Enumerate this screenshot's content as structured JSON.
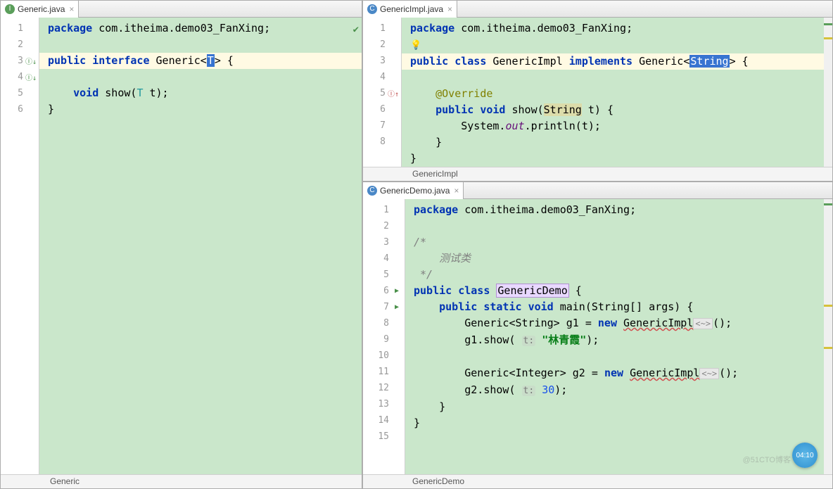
{
  "panes": {
    "left": {
      "tab": "Generic.java",
      "breadcrumb": "Generic",
      "lines": [
        "1",
        "2",
        "3",
        "4",
        "5",
        "6"
      ]
    },
    "topright": {
      "tab": "GenericImpl.java",
      "breadcrumb": "GenericImpl",
      "lines": [
        "1",
        "2",
        "3",
        "4",
        "5",
        "6",
        "7",
        "8"
      ]
    },
    "bottomright": {
      "tab": "GenericDemo.java",
      "breadcrumb": "GenericDemo",
      "lines": [
        "1",
        "2",
        "3",
        "4",
        "5",
        "6",
        "7",
        "8",
        "9",
        "10",
        "11",
        "12",
        "13",
        "14",
        "15"
      ]
    }
  },
  "code": {
    "pkgDecl": "com.itheima.demo03_FanXing",
    "kw": {
      "package": "package",
      "public": "public",
      "interface": "interface",
      "class": "class",
      "void": "void",
      "implements": "implements",
      "new": "new",
      "static": "static"
    },
    "generic": {
      "ifaceName": "Generic",
      "typeParam": "T",
      "method": "show",
      "param": "t"
    },
    "impl": {
      "className": "GenericImpl",
      "superIface": "Generic",
      "typeArg": "String",
      "override": "@Override",
      "paramType": "String",
      "body": "System.",
      "out": "out",
      "printlnCall": ".println(t);"
    },
    "demo": {
      "className": "GenericDemo",
      "commentOpen": "/*",
      "commentBody": "    测试类",
      "commentClose": " */",
      "mainSig": "main(String[] args) {",
      "g1decl": "Generic<String> g1 = ",
      "g1new": "GenericImpl",
      "fold": "<~>",
      "g1showPre": "g1.show( ",
      "g1hint": "t:",
      "g1lit": "\"林青霞\"",
      "g1showPost": ");",
      "g2decl": "Generic<Integer> g2 = ",
      "g2new": "GenericImpl",
      "g2showPre": "g2.show( ",
      "g2hint": "t:",
      "g2lit": "30",
      "g2showPost": ");"
    }
  },
  "badge": "04:10",
  "watermark": "@51CTO博客"
}
